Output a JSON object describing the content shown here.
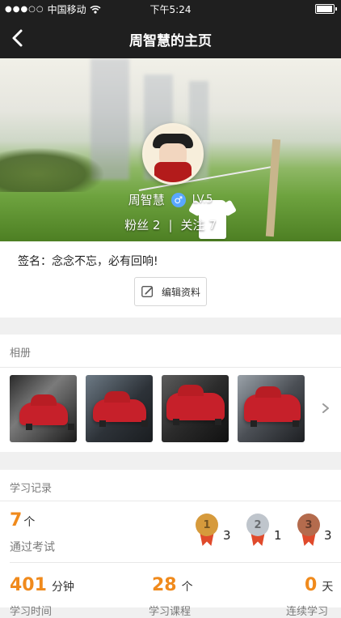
{
  "status_bar": {
    "carrier": "中国移动",
    "time": "下午5:24"
  },
  "nav": {
    "title": "周智慧的主页"
  },
  "profile": {
    "name": "周智慧",
    "gender_symbol": "♂",
    "level": "LV.5",
    "fans_label": "粉丝",
    "fans_count": "2",
    "follow_label": "关注",
    "follow_count": "7",
    "separator": "|",
    "signature": "签名：念念不忘，必有回响!",
    "edit_button": "编辑资料"
  },
  "album": {
    "title": "相册",
    "photos": [
      {
        "name": "photo-1"
      },
      {
        "name": "photo-2"
      },
      {
        "name": "photo-3"
      },
      {
        "name": "photo-4"
      }
    ]
  },
  "study": {
    "title": "学习记录",
    "passed_exams": {
      "count": "7",
      "unit": "个",
      "label": "通过考试"
    },
    "medals": [
      {
        "color": "#d69a3c",
        "glyph": "1",
        "count": "3"
      },
      {
        "color": "#bfc5cc",
        "glyph": "2",
        "count": "1"
      },
      {
        "color": "#b46b4d",
        "glyph": "3",
        "count": "3"
      }
    ],
    "metrics": [
      {
        "value": "401",
        "unit": "分钟",
        "label": "学习时间"
      },
      {
        "value": "28",
        "unit": "个",
        "label": "学习课程"
      },
      {
        "value": "0",
        "unit": "天",
        "label": "连续学习"
      }
    ]
  },
  "colors": {
    "accent_orange": "#f08a1c",
    "nav_bg": "#1f1f1f",
    "gender_blue": "#59a7ff"
  }
}
